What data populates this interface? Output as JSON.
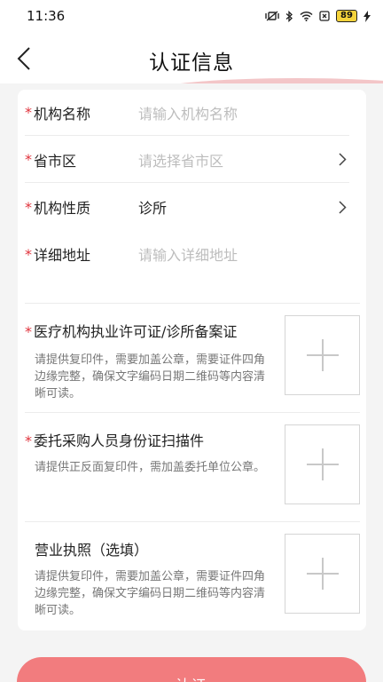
{
  "status_bar": {
    "time": "11:36",
    "battery": "89"
  },
  "header": {
    "title": "认证信息"
  },
  "form": {
    "required_mark": "*",
    "fields": [
      {
        "label": "机构名称",
        "placeholder": "请输入机构名称"
      },
      {
        "label": "省市区",
        "placeholder": "请选择省市区"
      },
      {
        "label": "机构性质",
        "value": "诊所"
      },
      {
        "label": "详细地址",
        "placeholder": "请输入详细地址"
      }
    ]
  },
  "uploads": [
    {
      "title": "医疗机构执业许可证/诊所备案证",
      "description": "请提供复印件，需要加盖公章，需要证件四角边缘完整，确保文字编码日期二维码等内容清晰可读。"
    },
    {
      "title": "委托采购人员身份证扫描件",
      "description": "请提供正反面复印件，需加盖委托单位公章。"
    },
    {
      "title": "营业执照（选填）",
      "description": "请提供复印件，需要加盖公章，需要证件四角边缘完整，确保文字编码日期二维码等内容清晰可读。"
    }
  ],
  "submit": {
    "label": "认证"
  },
  "colors": {
    "accent": "#f27c7e",
    "required": "#e0333c",
    "placeholder": "#bdbdbd"
  },
  "icons": [
    "back-arrow-icon",
    "chevron-right-icon",
    "plus-icon",
    "bluetooth-icon",
    "wifi-icon",
    "battery-icon"
  ]
}
